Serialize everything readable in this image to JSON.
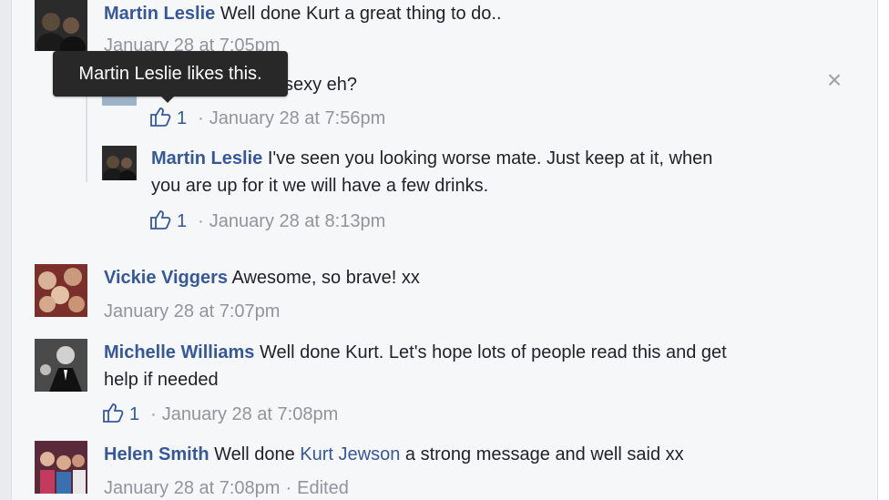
{
  "comments": [
    {
      "name": "Martin Leslie",
      "text": "Well done Kurt a great thing to do..",
      "time": "January 28 at 7:05pm"
    },
    {
      "name": "",
      "text": "sexy eh?",
      "likes": "1",
      "time": "January 28 at 7:56pm"
    },
    {
      "name": "Martin Leslie",
      "text": "I've seen you looking worse mate. Just keep at it, when",
      "text2": "you are up for it we will have a few drinks.",
      "likes": "1",
      "time": "January 28 at 8:13pm"
    },
    {
      "name": "Vickie Viggers",
      "text": "Awesome, so brave! xx",
      "time": "January 28 at 7:07pm"
    },
    {
      "name": "Michelle Williams",
      "text": "Well done Kurt. Let's hope lots of people read this and get",
      "text2": "help if needed",
      "likes": "1",
      "time": "January 28 at 7:08pm"
    },
    {
      "name": "Helen Smith",
      "text_pre": "Well done",
      "mention": "Kurt Jewson",
      "text_post": "a strong message and well said xx",
      "time": "January 28 at 7:08pm",
      "edited": "Edited"
    }
  ],
  "tooltip": "Martin Leslie likes this.",
  "close_glyph": "×",
  "colors": {
    "link": "#365899",
    "meta": "#90949c",
    "tooltip_bg": "#282828"
  }
}
